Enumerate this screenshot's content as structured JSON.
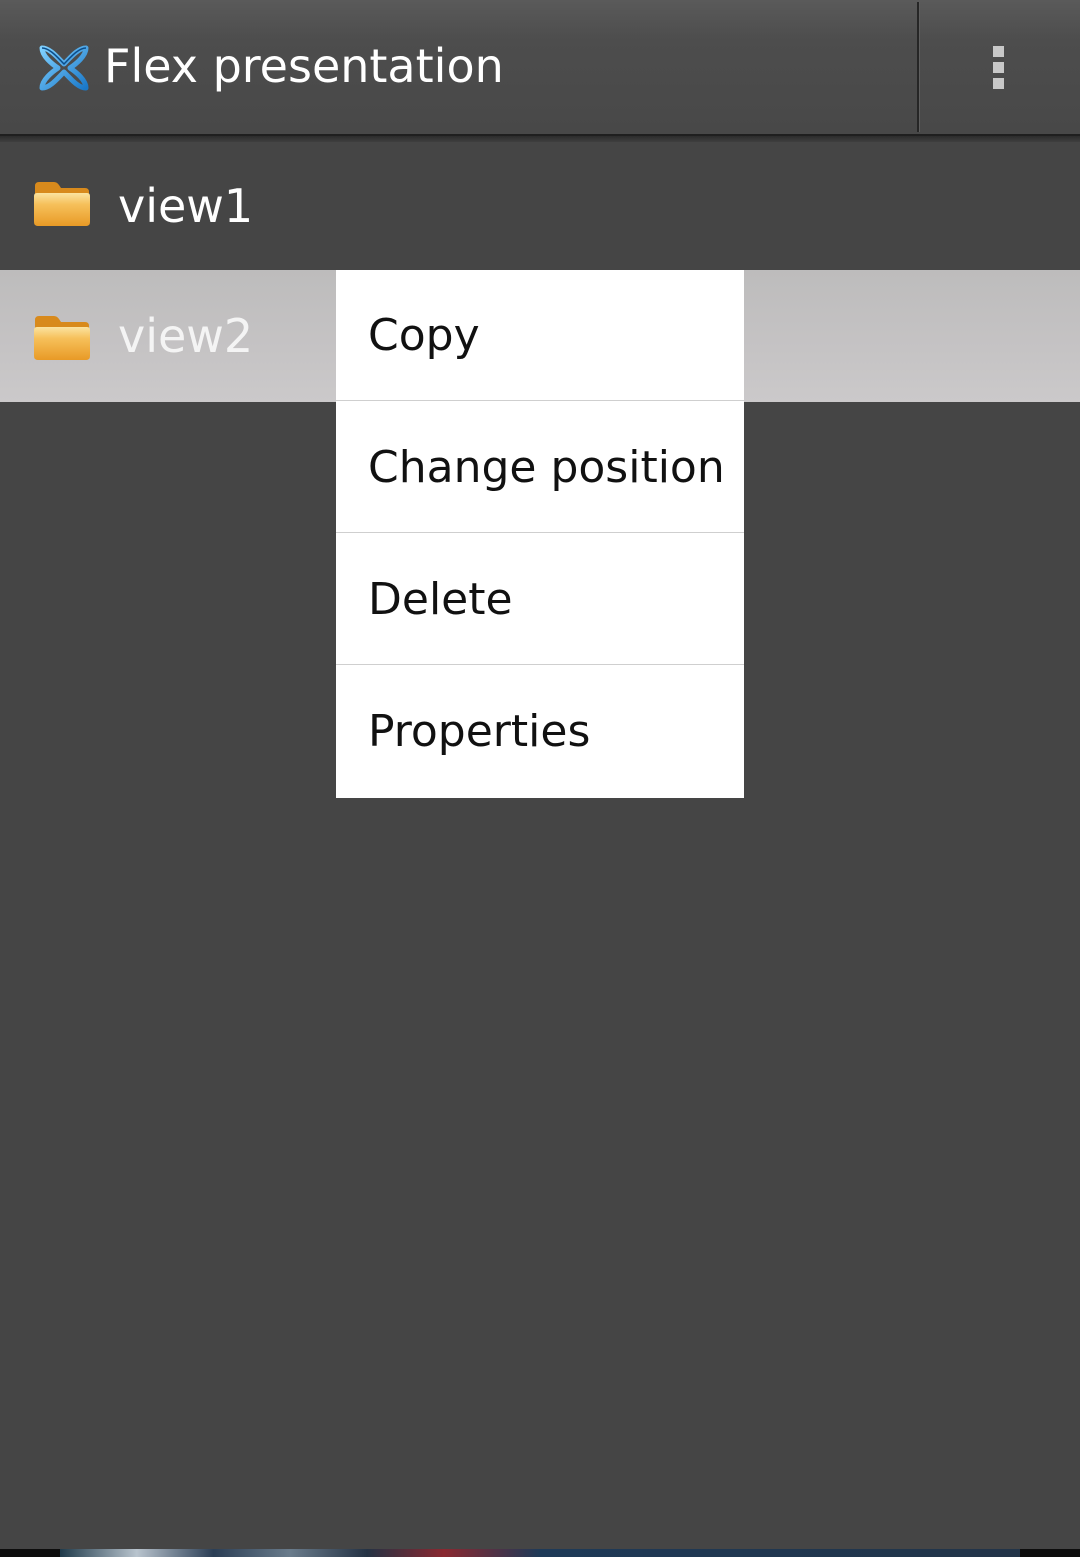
{
  "action_bar": {
    "title": "Flex presentation",
    "logo_icon": "flex-x-logo-icon",
    "overflow_icon": "overflow-menu-icon"
  },
  "list": {
    "items": [
      {
        "label": "view1",
        "icon": "folder-icon",
        "selected": false
      },
      {
        "label": "view2",
        "icon": "folder-icon",
        "selected": true
      }
    ]
  },
  "context_menu": {
    "items": [
      {
        "label": "Copy"
      },
      {
        "label": "Change position"
      },
      {
        "label": "Delete"
      },
      {
        "label": "Properties"
      }
    ]
  },
  "colors": {
    "background": "#454545",
    "action_bar": "#4d4d4d",
    "selected_row": "#c5c3c4",
    "menu_background": "#ffffff",
    "menu_text": "#111111",
    "logo_blue": "#2f9be0",
    "folder_orange": "#f0b040"
  }
}
